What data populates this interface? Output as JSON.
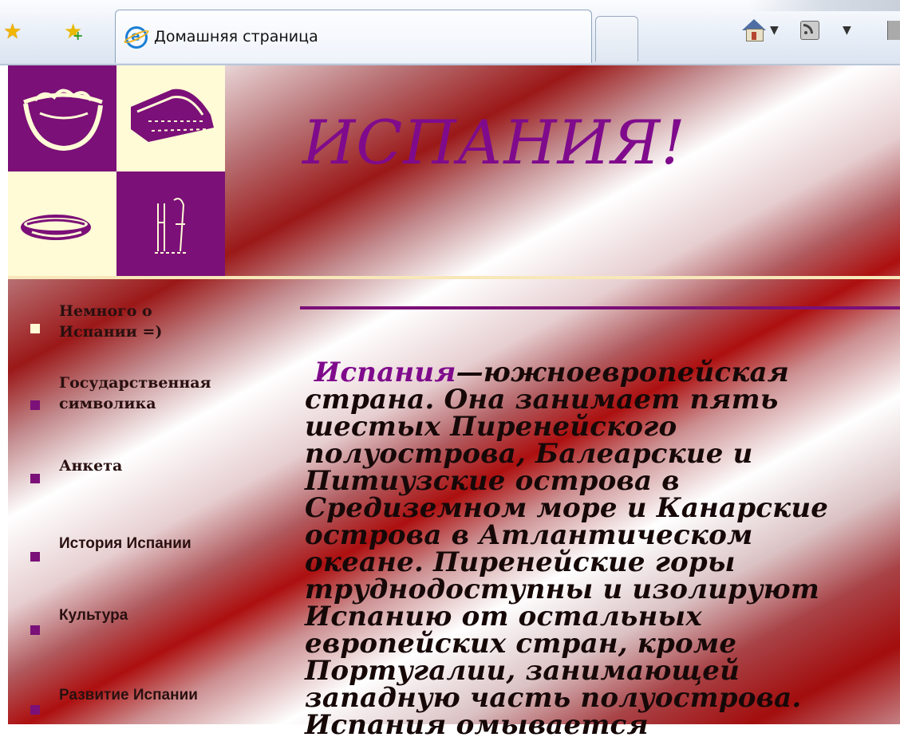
{
  "browser": {
    "tab_title": "Домашняя страница",
    "icons": [
      "favorites-star-icon",
      "add-favorites-icon",
      "ie-icon",
      "home-icon",
      "feeds-icon",
      "print-icon"
    ]
  },
  "site": {
    "title": "ИСПАНИЯ!",
    "colors": {
      "purple": "#7b1078",
      "cream": "#fffbd6",
      "dark_red": "#a30d0d"
    },
    "logo_icons": [
      "bowl-icon",
      "cake-slice-icon",
      "hotdog-icon",
      "kitchen-utensils-icon"
    ]
  },
  "nav": {
    "items": [
      {
        "label_line1": "Немного о",
        "label_line2": "Испании  =)",
        "bullet_color": "#fffbd6"
      },
      {
        "label_line1": "Государственная",
        "label_line2": "символика",
        "bullet_color": "#7b1078"
      },
      {
        "label_line1": "Анкета",
        "label_line2": "",
        "bullet_color": "#7b1078"
      },
      {
        "label_line1": "История Испании",
        "label_line2": "",
        "bullet_color": "#7b1078"
      },
      {
        "label_line1": "Культура",
        "label_line2": "",
        "bullet_color": "#7b1078"
      },
      {
        "label_line1": "Развитие Испании",
        "label_line2": "",
        "bullet_color": "#7b1078"
      }
    ]
  },
  "content": {
    "highlight": "Испания",
    "lines": [
      "—южноевропейская",
      "страна. Она занимает пять",
      "шестых Пиренейского",
      "полуострова, Балеарские и",
      "Питиузские острова в",
      "Средиземном море и Канарские",
      "острова в Атлантическом",
      "океане. Пиренейские горы",
      "труднодоступны и изолируют",
      "Испанию от остальных",
      "европейских стран, кроме",
      "Португалии, занимающей",
      "западную часть полуострова.",
      "Испания омывается"
    ]
  }
}
